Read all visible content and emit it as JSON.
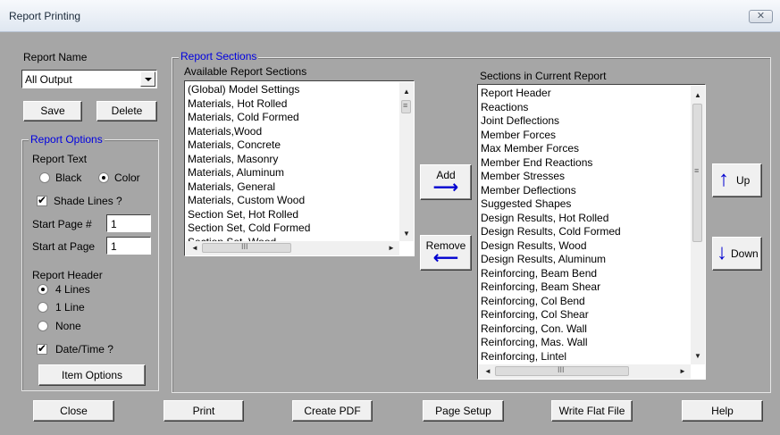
{
  "window": {
    "title": "Report Printing",
    "close_label": "✕"
  },
  "report_name": {
    "label": "Report Name",
    "selected": "All Output",
    "save_label": "Save",
    "delete_label": "Delete"
  },
  "report_options": {
    "legend": "Report Options",
    "report_text_label": "Report Text",
    "black_label": "Black",
    "color_label": "Color",
    "shade_lines_label": "Shade Lines ?",
    "start_page_label": "Start Page #",
    "start_page_value": "1",
    "start_at_page_label": "Start at Page",
    "start_at_page_value": "1",
    "report_header_label": "Report Header",
    "header_4_label": "4 Lines",
    "header_1_label": "1 Line",
    "header_none_label": "None",
    "date_time_label": "Date/Time ?",
    "item_options_label": "Item Options"
  },
  "report_sections": {
    "legend": "Report Sections",
    "available_label": "Available Report Sections",
    "available": [
      "(Global) Model Settings",
      "Materials, Hot Rolled",
      "Materials, Cold Formed",
      "Materials,Wood",
      "Materials, Concrete",
      "Materials, Masonry",
      "Materials, Aluminum",
      "Materials, General",
      "Materials, Custom Wood",
      "Section Set, Hot Rolled",
      "Section Set, Cold Formed",
      "Section Set, Wood"
    ],
    "current_label": "Sections in Current Report",
    "current": [
      "Report Header",
      "Reactions",
      "Joint Deflections",
      "Member Forces",
      "Max Member Forces",
      "Member End Reactions",
      "Member Stresses",
      "Member Deflections",
      "Suggested Shapes",
      "Design Results, Hot Rolled",
      "Design Results, Cold Formed",
      "Design Results, Wood",
      "Design Results, Aluminum",
      "Reinforcing, Beam Bend",
      "Reinforcing, Beam Shear",
      "Reinforcing, Col Bend",
      "Reinforcing, Col Shear",
      "Reinforcing, Con. Wall",
      "Reinforcing, Mas. Wall",
      "Reinforcing, Lintel"
    ],
    "add_label": "Add",
    "remove_label": "Remove",
    "up_label": "Up",
    "down_label": "Down"
  },
  "footer": {
    "close_label": "Close",
    "print_label": "Print",
    "create_pdf_label": "Create PDF",
    "page_setup_label": "Page Setup",
    "write_flat_file_label": "Write Flat File",
    "help_label": "Help"
  },
  "icons": {
    "right_arrow": "⟶",
    "left_arrow": "⟵",
    "up_arrow": "↑",
    "down_arrow": "↓",
    "scroll_up": "▲",
    "scroll_down": "▼",
    "scroll_left": "◄",
    "scroll_right": "►",
    "grip": "≡",
    "hgrip": "III"
  }
}
